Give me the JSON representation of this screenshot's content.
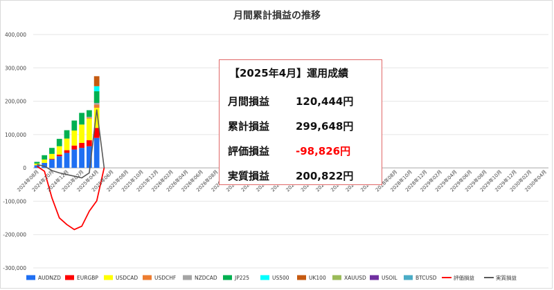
{
  "title": "月間累計損益の推移",
  "summary": {
    "title": "【2025年4月】運用成績",
    "rows": [
      {
        "label": "月間損益",
        "value": "120,444円",
        "highlight": false
      },
      {
        "label": "累計損益",
        "value": "299,648円",
        "highlight": false
      },
      {
        "label": "評価損益",
        "value": "-98,826円",
        "highlight": true
      },
      {
        "label": "実質損益",
        "value": "200,822円",
        "highlight": false
      }
    ]
  },
  "colors": {
    "AUDNZD": "#1f6ff2",
    "EURGBP": "#ff0000",
    "USDCAD": "#ffff00",
    "USDCHF": "#ed7d31",
    "NZDCAD": "#a5a5a5",
    "JP225": "#00b050",
    "US500": "#00ffff",
    "UK100": "#c55a11",
    "XAUUSD": "#9bbb59",
    "USOIL": "#7030a0",
    "BTCUSD": "#4bacc6",
    "評価損益": "#ff0000",
    "実質損益": "#595959",
    "highlight_text": "#ff0000"
  },
  "chart_data": {
    "type": "bar",
    "stacked": true,
    "categories": [
      "2024年08月",
      "2024年09月",
      "2024年10月",
      "2024年11月",
      "2024年12月",
      "2025年01月",
      "2025年02月",
      "2025年03月",
      "2025年04月",
      "2025年05月",
      "2025年06月",
      "2025年07月",
      "2025年08月",
      "2025年09月",
      "2025年10月",
      "2025年11月",
      "2025年12月",
      "2026年01月",
      "2026年02月",
      "2026年03月",
      "2026年04月",
      "2026年05月",
      "2026年06月",
      "2026年07月",
      "2026年08月",
      "2026年09月",
      "2026年10月",
      "2026年11月",
      "2026年12月",
      "2027年01月",
      "2027年02月",
      "2027年03月",
      "2027年04月",
      "2027年05月",
      "2027年06月",
      "2027年07月",
      "2027年08月",
      "2027年09月",
      "2027年10月",
      "2027年11月",
      "2027年12月",
      "2028年01月",
      "2028年02月",
      "2028年03月",
      "2028年04月",
      "2028年05月",
      "2028年06月",
      "2028年07月",
      "2028年08月",
      "2028年09月",
      "2028年10月",
      "2028年11月",
      "2028年12月",
      "2029年01月",
      "2029年02月",
      "2029年03月",
      "2029年04月",
      "2029年05月",
      "2029年06月",
      "2029年07月",
      "2029年08月",
      "2029年09月",
      "2029年10月",
      "2029年11月",
      "2029年12月",
      "2030年01月",
      "2030年02月",
      "2030年03月",
      "2030年04月"
    ],
    "tick_labels": [
      "2024年08月",
      "2024年10月",
      "2024年12月",
      "2025年02月",
      "2025年04月",
      "2025年06月",
      "2025年08月",
      "2025年10月",
      "2025年12月",
      "2026年02月",
      "2026年04月",
      "2026年06月",
      "2026年08月",
      "2026年10月",
      "2026年12月",
      "2027年02月",
      "2027年04月",
      "2027年06月",
      "2027年08月",
      "2027年10月",
      "2027年12月",
      "2028年02月",
      "2028年04月",
      "2028年06月",
      "2028年08月",
      "2028年10月",
      "2028年12月",
      "2029年02月",
      "2029年04月",
      "2029年06月",
      "2029年08月",
      "2029年10月",
      "2029年12月",
      "2030年02月",
      "2030年04月"
    ],
    "yticks": [
      "400,000",
      "300,000",
      "200,000",
      "100,000",
      "0",
      "-100,000",
      "-200,000",
      "-300,000"
    ],
    "ylim": [
      -300000,
      400000
    ],
    "series": [
      {
        "name": "AUDNZD",
        "kind": "bar",
        "values": [
          8000,
          15000,
          25000,
          35000,
          45000,
          55000,
          60000,
          65000,
          90000
        ]
      },
      {
        "name": "EURGBP",
        "kind": "bar",
        "values": [
          0,
          0,
          2000,
          5000,
          8000,
          12000,
          15000,
          18000,
          30000
        ]
      },
      {
        "name": "USDCAD",
        "kind": "bar",
        "values": [
          5000,
          10000,
          15000,
          25000,
          35000,
          45000,
          55000,
          65000,
          60000
        ]
      },
      {
        "name": "USDCHF",
        "kind": "bar",
        "values": [
          0,
          0,
          0,
          0,
          0,
          0,
          0,
          3000,
          10000
        ]
      },
      {
        "name": "NZDCAD",
        "kind": "bar",
        "values": [
          0,
          0,
          0,
          0,
          0,
          0,
          0,
          2000,
          5000
        ]
      },
      {
        "name": "JP225",
        "kind": "bar",
        "values": [
          5000,
          13000,
          18000,
          22000,
          25000,
          30000,
          35000,
          20000,
          35000
        ]
      },
      {
        "name": "US500",
        "kind": "bar",
        "values": [
          0,
          0,
          0,
          0,
          0,
          0,
          0,
          0,
          15000
        ]
      },
      {
        "name": "UK100",
        "kind": "bar",
        "values": [
          0,
          0,
          0,
          0,
          0,
          0,
          0,
          0,
          30000
        ]
      },
      {
        "name": "XAUUSD",
        "kind": "bar",
        "values": [
          0,
          0,
          0,
          0,
          0,
          0,
          0,
          0,
          0
        ]
      },
      {
        "name": "USOIL",
        "kind": "bar",
        "values": [
          0,
          0,
          0,
          0,
          0,
          0,
          0,
          0,
          0
        ]
      },
      {
        "name": "BTCUSD",
        "kind": "bar",
        "values": [
          0,
          0,
          0,
          0,
          0,
          0,
          0,
          0,
          0
        ]
      },
      {
        "name": "評価損益",
        "kind": "line",
        "values": [
          5000,
          -10000,
          -90000,
          -150000,
          -170000,
          -185000,
          -175000,
          -130000,
          -99000,
          0
        ]
      },
      {
        "name": "実質損益",
        "kind": "line",
        "values": [
          10000,
          5000,
          -8000,
          -15000,
          -20000,
          -25000,
          -30000,
          -15000,
          175000,
          0
        ]
      }
    ],
    "legend": [
      "AUDNZD",
      "EURGBP",
      "USDCAD",
      "USDCHF",
      "NZDCAD",
      "JP225",
      "US500",
      "UK100",
      "XAUUSD",
      "USOIL",
      "BTCUSD",
      "評価損益",
      "実質損益"
    ],
    "legend_position": "bottom",
    "grid": true
  }
}
